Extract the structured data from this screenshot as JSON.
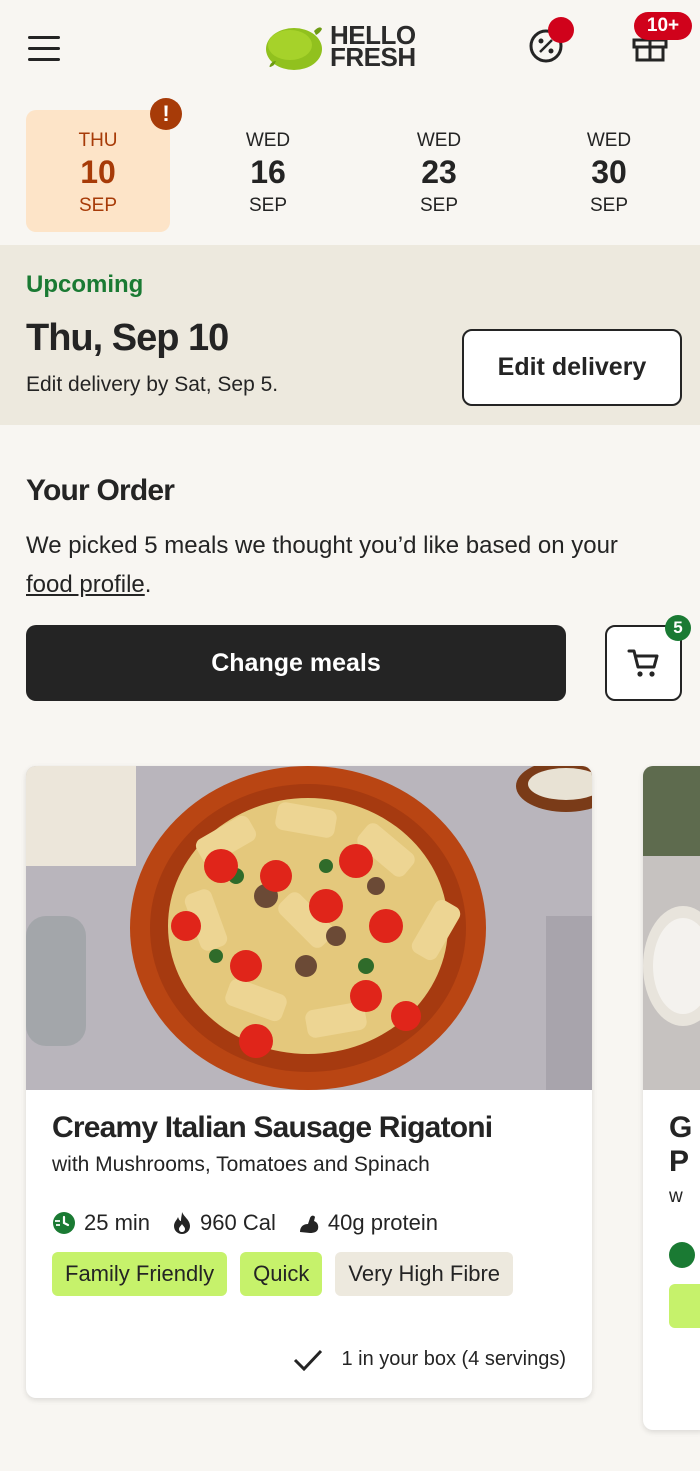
{
  "header": {
    "brand_line1": "HELLO",
    "brand_line2": "FRESH",
    "gift_badge": "10+",
    "icons": {
      "menu": "hamburger-menu-icon",
      "discount": "discount-percent-icon",
      "gift": "gift-icon"
    }
  },
  "dates": [
    {
      "dow": "THU",
      "day": "10",
      "mon": "SEP",
      "active": true,
      "alert": "!"
    },
    {
      "dow": "WED",
      "day": "16",
      "mon": "SEP"
    },
    {
      "dow": "WED",
      "day": "23",
      "mon": "SEP"
    },
    {
      "dow": "WED",
      "day": "30",
      "mon": "SEP"
    }
  ],
  "delivery": {
    "status": "Upcoming",
    "date": "Thu, Sep 10",
    "deadline": "Edit delivery by Sat, Sep 5.",
    "edit_label": "Edit delivery"
  },
  "order": {
    "title": "Your Order",
    "desc_prefix": "We picked 5 meals we thought you’d like based on your ",
    "desc_link": "food profile",
    "desc_suffix": ".",
    "change_label": "Change meals",
    "cart_count": "5"
  },
  "meal": {
    "title": "Creamy Italian Sausage Rigatoni",
    "subtitle": "with Mushrooms, Tomatoes and Spinach",
    "time": "25 min",
    "calories": "960 Cal",
    "protein": "40g protein",
    "tags": [
      "Family Friendly",
      "Quick",
      "Very High Fibre"
    ],
    "in_box": "1 in your box (4 servings)"
  },
  "peek": {
    "title_partial": "G\nP",
    "sub_partial": "w"
  },
  "colors": {
    "brand_green": "#1a7a33",
    "lime": "#91c11e",
    "alert": "#d0021b",
    "active_tab": "#fde4c8",
    "tag_green": "#c6f26b"
  }
}
